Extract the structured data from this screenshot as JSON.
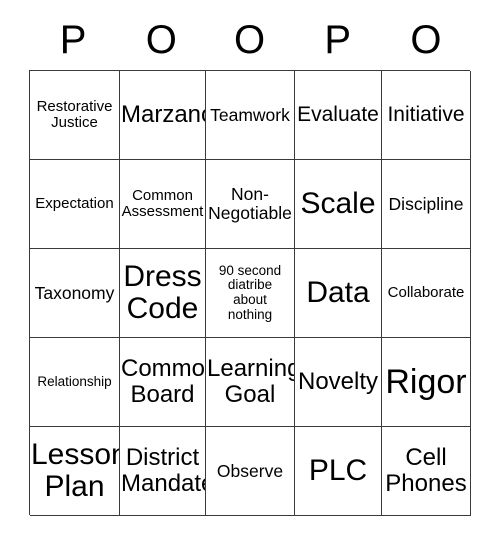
{
  "card": {
    "header_letters": [
      "P",
      "O",
      "O",
      "P",
      "O"
    ],
    "rows": [
      [
        {
          "text": "Restorative\nJustice",
          "size": "sm"
        },
        {
          "text": "Marzano",
          "size": "xl"
        },
        {
          "text": "Teamwork",
          "size": "md"
        },
        {
          "text": "Evaluate",
          "size": "lg"
        },
        {
          "text": "Initiative",
          "size": "lg"
        }
      ],
      [
        {
          "text": "Expectation",
          "size": "sm"
        },
        {
          "text": "Common\nAssessment",
          "size": "sm"
        },
        {
          "text": "Non-\nNegotiable",
          "size": "md"
        },
        {
          "text": "Scale",
          "size": "xxl"
        },
        {
          "text": "Discipline",
          "size": "md"
        }
      ],
      [
        {
          "text": "Taxonomy",
          "size": "md"
        },
        {
          "text": "Dress\nCode",
          "size": "xxl"
        },
        {
          "text": "90 second\ndiatribe\nabout\nnothing",
          "size": "xs"
        },
        {
          "text": "Data",
          "size": "xxl"
        },
        {
          "text": "Collaborate",
          "size": "sm"
        }
      ],
      [
        {
          "text": "Relationship",
          "size": "xs"
        },
        {
          "text": "Common\nBoard",
          "size": "xl"
        },
        {
          "text": "Learning\nGoal",
          "size": "xl"
        },
        {
          "text": "Novelty",
          "size": "xl"
        },
        {
          "text": "Rigor",
          "size": "huge"
        }
      ],
      [
        {
          "text": "Lesson\nPlan",
          "size": "xxl"
        },
        {
          "text": "District\nMandate",
          "size": "xl"
        },
        {
          "text": "Observe",
          "size": "md"
        },
        {
          "text": "PLC",
          "size": "xxl"
        },
        {
          "text": "Cell\nPhones",
          "size": "xl"
        }
      ]
    ]
  },
  "colors": {
    "background": "#ffffff",
    "text": "#000000",
    "border": "#3a3a3a"
  }
}
